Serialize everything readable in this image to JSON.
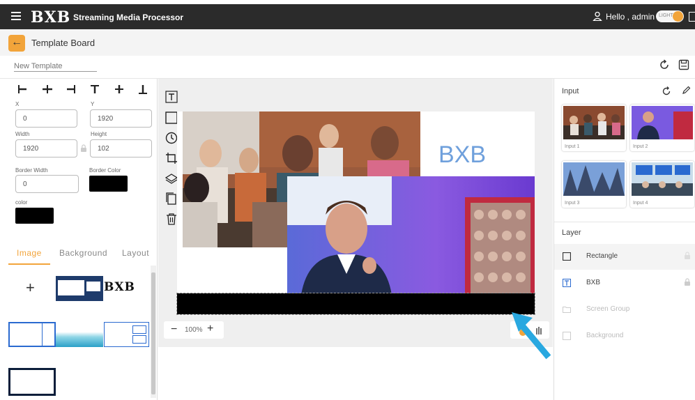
{
  "header": {
    "logo": "BXB",
    "app_title": "Streaming Media Processor",
    "greeting": "Hello , admin",
    "theme_toggle_label": "LIGHT"
  },
  "titlebar": {
    "title": "Template Board"
  },
  "template_name": {
    "placeholder": "New Template"
  },
  "properties": {
    "x_label": "X",
    "x_value": "0",
    "y_label": "Y",
    "y_value": "1920",
    "width_label": "Width",
    "width_value": "1920",
    "height_label": "Height",
    "height_value": "102",
    "border_width_label": "Border Width",
    "border_width_value": "0",
    "border_color_label": "Border Color",
    "border_color_value": "#000000",
    "color_label": "color",
    "color_value": "#000000"
  },
  "asset_tabs": [
    {
      "label": "Image"
    },
    {
      "label": "Background"
    },
    {
      "label": "Layout"
    }
  ],
  "asset_thumbs": {
    "add_label": "+",
    "logo_text": "BXB"
  },
  "canvas": {
    "text_element": "BXB",
    "zoom_minus": "−",
    "zoom_value": "100%",
    "zoom_plus": "+"
  },
  "inputs_panel": {
    "title": "Input",
    "cards": [
      {
        "label": "Input 1"
      },
      {
        "label": "Input 2"
      },
      {
        "label": "Input 3"
      },
      {
        "label": "Input 4"
      }
    ]
  },
  "layers_panel": {
    "title": "Layer",
    "items": [
      {
        "label": "Rectangle"
      },
      {
        "label": "BXB"
      },
      {
        "label": "Screen Group"
      },
      {
        "label": "Background"
      }
    ]
  },
  "colors": {
    "accent": "#f2a43a",
    "topbar": "#2b2b2b",
    "text_element": "#6fa0dc",
    "annotation_arrow": "#29a8e0"
  }
}
